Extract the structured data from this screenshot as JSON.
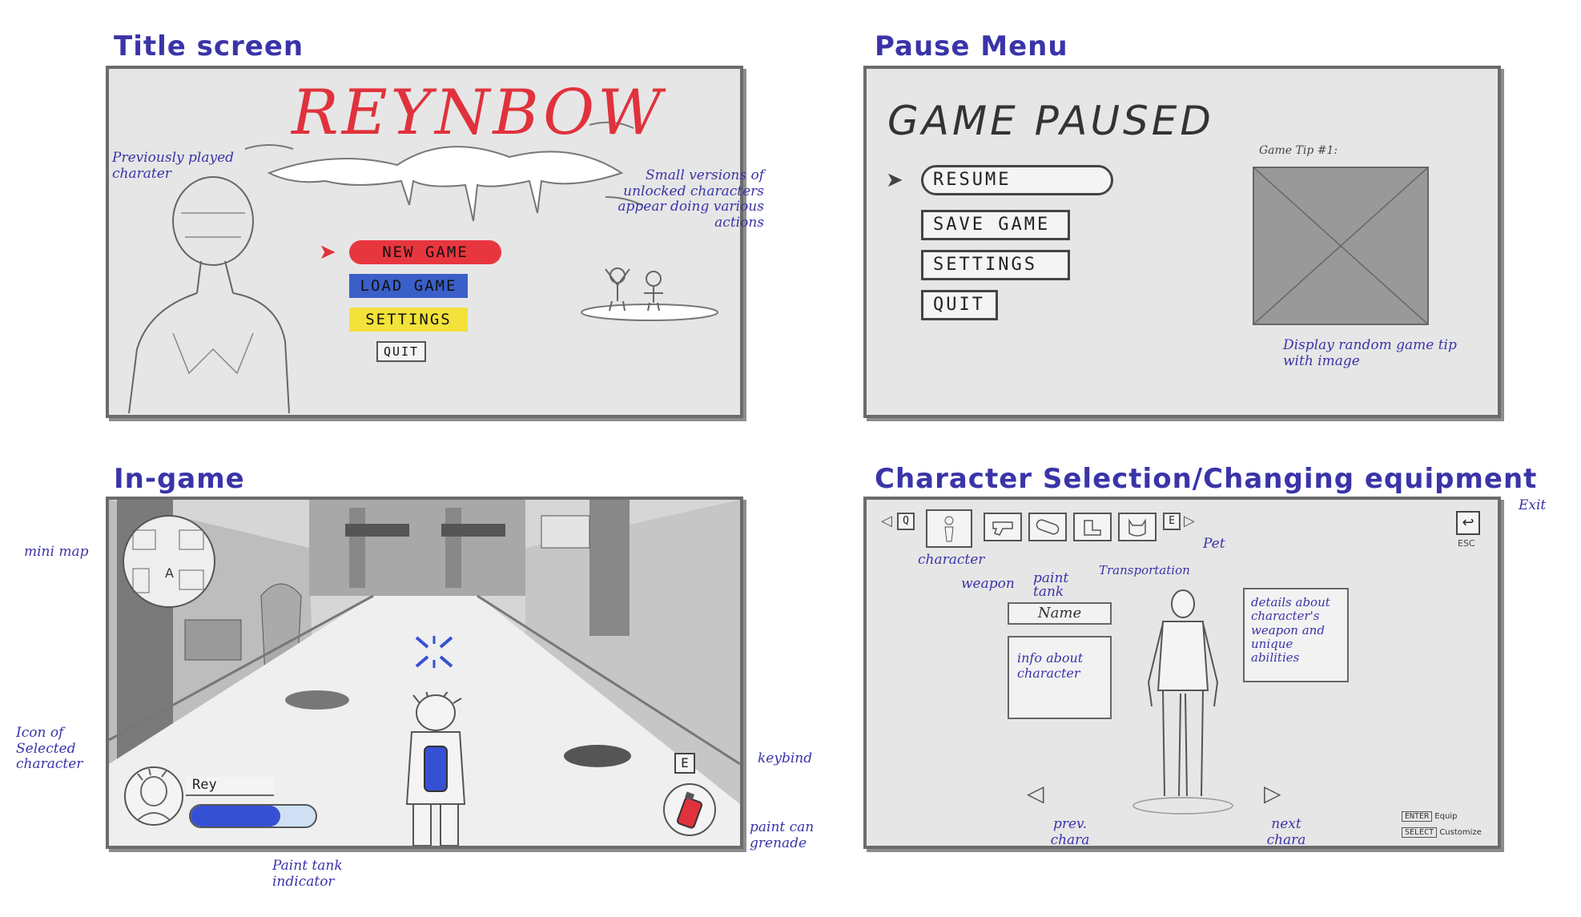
{
  "sections": {
    "title_screen": "Title screen",
    "pause_menu": "Pause Menu",
    "in_game": "In-game",
    "char_select": "Character Selection/Changing equipment"
  },
  "title": {
    "logo": "REYNBOW",
    "menu": {
      "new_game": "NEW GAME",
      "load_game": "LOAD GAME",
      "settings": "SETTINGS",
      "quit": "QUIT"
    },
    "notes": {
      "prev_character": "Previously played charater",
      "small_versions": "Small versions of unlocked characters appear doing various actions"
    },
    "colors": {
      "new_game": "#e8363f",
      "load_game": "#3a5fc8",
      "settings": "#f2e23a"
    }
  },
  "pause": {
    "title": "GAME PAUSED",
    "menu": {
      "resume": "RESUME",
      "save_game": "SAVE GAME",
      "settings": "SETTINGS",
      "quit": "QUIT"
    },
    "tip_label": "Game Tip #1:",
    "note": "Display random game tip with image"
  },
  "ingame": {
    "player_name": "Rey",
    "paint_tank_level": 0.72,
    "keybind": "E",
    "minimap_marker": "A",
    "notes": {
      "mini_map": "mini map",
      "icon_selected": "Icon of Selected character",
      "paint_tank": "Paint tank indicator",
      "keybind": "keybind",
      "grenade": "paint can grenade"
    }
  },
  "charsel": {
    "key_prev": "Q",
    "key_next": "E",
    "exit_key": "ESC",
    "name_field": "Name",
    "info_box": "info about character",
    "details_box": "details about character's weapon and unique abilities",
    "hints": {
      "enter_key": "ENTER",
      "enter_action": "Equip",
      "select_key": "SELECT",
      "select_action": "Customize"
    },
    "notes": {
      "character": "character",
      "weapon": "weapon",
      "paint_tank": "paint tank",
      "transportation": "Transportation",
      "pet": "Pet",
      "exit": "Exit",
      "prev": "prev. chara",
      "next": "next chara"
    }
  }
}
